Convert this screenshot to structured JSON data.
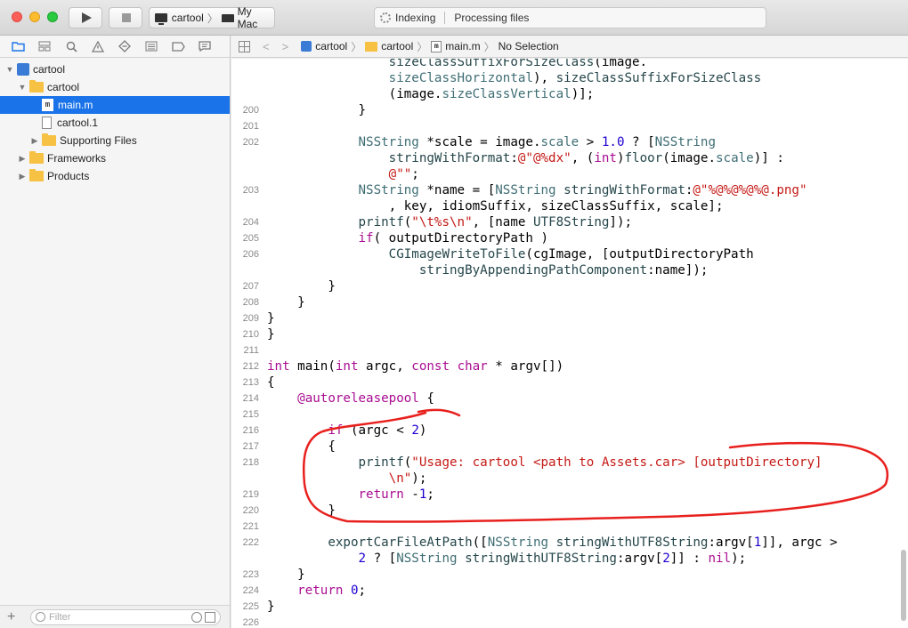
{
  "toolbar": {
    "scheme_target": "cartool",
    "scheme_device": "My Mac",
    "activity_status": "Indexing",
    "activity_detail": "Processing files"
  },
  "navigator": {
    "tree": [
      {
        "label": "cartool",
        "kind": "project",
        "disclosure": "open",
        "indent": 0
      },
      {
        "label": "cartool",
        "kind": "folder",
        "disclosure": "open",
        "indent": 1
      },
      {
        "label": "main.m",
        "kind": "m-file",
        "disclosure": "none",
        "indent": 2,
        "selected": true
      },
      {
        "label": "cartool.1",
        "kind": "file",
        "disclosure": "none",
        "indent": 2
      },
      {
        "label": "Supporting Files",
        "kind": "folder",
        "disclosure": "closed",
        "indent": 2
      },
      {
        "label": "Frameworks",
        "kind": "folder",
        "disclosure": "closed",
        "indent": 1
      },
      {
        "label": "Products",
        "kind": "folder",
        "disclosure": "closed",
        "indent": 1
      }
    ],
    "filter_placeholder": "Filter"
  },
  "jumpbar": {
    "crumbs": [
      "cartool",
      "cartool",
      "main.m",
      "No Selection"
    ]
  },
  "editor": {
    "lines": [
      {
        "n": "",
        "html": "                <span class=\"sel\">sizeClassSuffixForSizeClass</span>(image."
      },
      {
        "n": "",
        "html": "                <span class=\"prop\">sizeClassHorizontal</span>), <span class=\"sel\">sizeClassSuffixForSizeClass</span>"
      },
      {
        "n": "",
        "html": "                (image.<span class=\"prop\">sizeClassVertical</span>)];"
      },
      {
        "n": "200",
        "html": "            }"
      },
      {
        "n": "201",
        "html": ""
      },
      {
        "n": "202",
        "html": "            <span class=\"cls\">NSString</span> *scale = image.<span class=\"prop\">scale</span> &gt; <span class=\"num\">1.0</span> ? [<span class=\"cls\">NSString</span>"
      },
      {
        "n": "",
        "html": "                <span class=\"sel\">stringWithFormat</span>:<span class=\"str\">@\"@%dx\"</span>, (<span class=\"kw\">int</span>)<span class=\"fn\">floor</span>(image.<span class=\"prop\">scale</span>)] :"
      },
      {
        "n": "",
        "html": "                <span class=\"str\">@\"\"</span>;"
      },
      {
        "n": "203",
        "html": "            <span class=\"cls\">NSString</span> *name = [<span class=\"cls\">NSString</span> <span class=\"sel\">stringWithFormat</span>:<span class=\"str\">@\"%@%@%@%@.png\"</span>"
      },
      {
        "n": "",
        "html": "                , key, idiomSuffix, sizeClassSuffix, scale];"
      },
      {
        "n": "204",
        "html": "            <span class=\"fn\">printf</span>(<span class=\"str\">\"\\t%s\\n\"</span>, [name <span class=\"sel\">UTF8String</span>]);"
      },
      {
        "n": "205",
        "html": "            <span class=\"kw\">if</span>( outputDirectoryPath )"
      },
      {
        "n": "206",
        "html": "                <span class=\"fn\">CGImageWriteToFile</span>(cgImage, [outputDirectoryPath"
      },
      {
        "n": "",
        "html": "                    <span class=\"sel\">stringByAppendingPathComponent</span>:name]);"
      },
      {
        "n": "207",
        "html": "        }"
      },
      {
        "n": "208",
        "html": "    }"
      },
      {
        "n": "209",
        "html": "}"
      },
      {
        "n": "210",
        "html": "}"
      },
      {
        "n": "211",
        "html": ""
      },
      {
        "n": "212",
        "html": "<span class=\"kw\">int</span> main(<span class=\"kw\">int</span> argc, <span class=\"kw\">const</span> <span class=\"kw\">char</span> * argv[])"
      },
      {
        "n": "213",
        "html": "{"
      },
      {
        "n": "214",
        "html": "    <span class=\"kw\">@autoreleasepool</span> {"
      },
      {
        "n": "215",
        "html": ""
      },
      {
        "n": "216",
        "html": "        <span class=\"kw\">if</span> (argc &lt; <span class=\"num\">2</span>)"
      },
      {
        "n": "217",
        "html": "        {"
      },
      {
        "n": "218",
        "html": "            <span class=\"fn\">printf</span>(<span class=\"str\">\"Usage: cartool &lt;path to Assets.car&gt; [outputDirectory]</span>"
      },
      {
        "n": "",
        "html": "<span class=\"str\">                \\n\"</span>);"
      },
      {
        "n": "219",
        "html": "            <span class=\"kw\">return</span> -<span class=\"num\">1</span>;"
      },
      {
        "n": "220",
        "html": "        }"
      },
      {
        "n": "221",
        "html": ""
      },
      {
        "n": "222",
        "html": "        <span class=\"fn\">exportCarFileAtPath</span>([<span class=\"cls\">NSString</span> <span class=\"sel\">stringWithUTF8String</span>:argv[<span class=\"num\">1</span>]], argc &gt;"
      },
      {
        "n": "",
        "html": "            <span class=\"num\">2</span> ? [<span class=\"cls\">NSString</span> <span class=\"sel\">stringWithUTF8String</span>:argv[<span class=\"num\">2</span>]] : <span class=\"kw\">nil</span>);"
      },
      {
        "n": "223",
        "html": "    }"
      },
      {
        "n": "224",
        "html": "    <span class=\"kw\">return</span> <span class=\"num\">0</span>;"
      },
      {
        "n": "225",
        "html": "}"
      },
      {
        "n": "226",
        "html": ""
      }
    ]
  },
  "colors": {
    "selection": "#1a73e8",
    "annotation": "#e8201d",
    "keyword": "#a90d91",
    "string": "#c41a16",
    "number": "#1c00cf"
  }
}
